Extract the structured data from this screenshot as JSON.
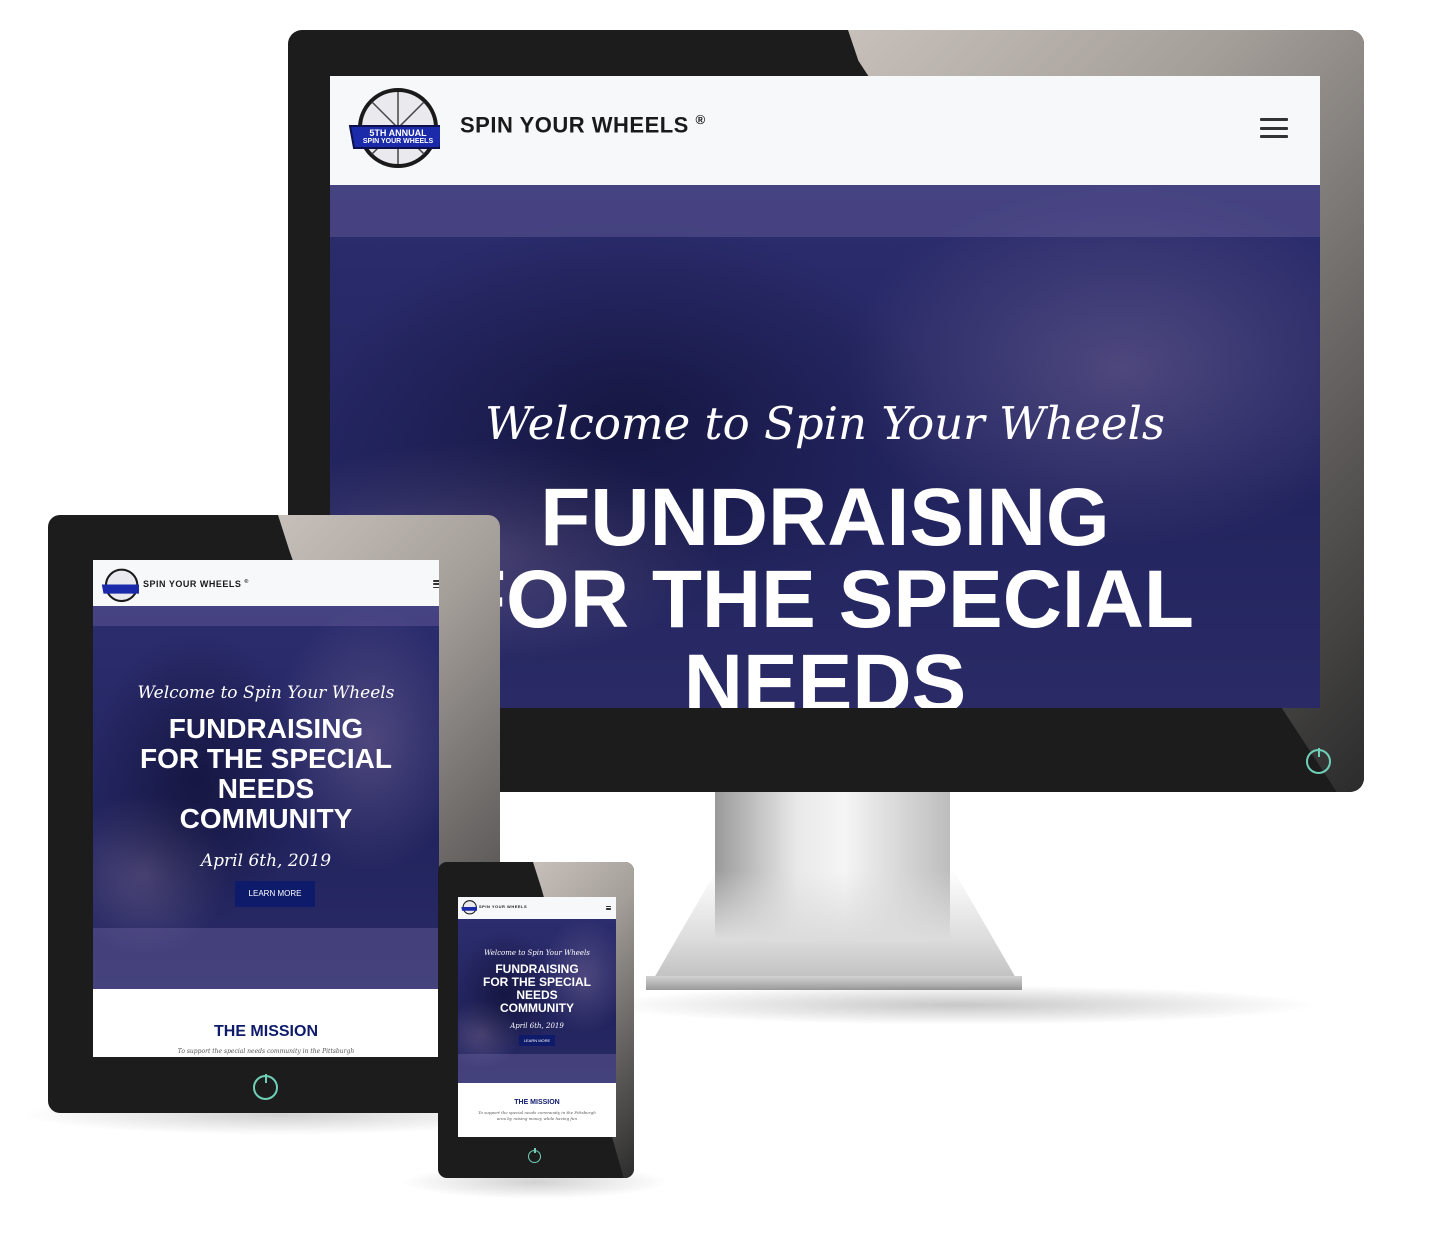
{
  "site": {
    "brand": "SPIN YOUR WHEELS",
    "registered": "®",
    "logo_text_line1": "5TH ANNUAL",
    "logo_text_line2": "SPIN YOUR WHEELS",
    "menu_icon": "hamburger-icon"
  },
  "hero": {
    "welcome": "Welcome to Spin Your Wheels",
    "headline_line1": "FUNDRAISING",
    "headline_line2": "FOR THE SPECIAL",
    "headline_line3": "NEEDS",
    "headline_line4": "COMMUNITY",
    "date": "April 6th, 2019",
    "cta": "LEARN MORE"
  },
  "mission": {
    "title": "THE MISSION",
    "text_line1": "To support the special needs community in the Pittsburgh",
    "text_line2": "area by raising money while having fun"
  },
  "colors": {
    "navy": "#0e1b6b",
    "hero_bg": "#2c2d6e",
    "power_led": "#6fd0b8",
    "bezel": "#1c1c1c"
  }
}
